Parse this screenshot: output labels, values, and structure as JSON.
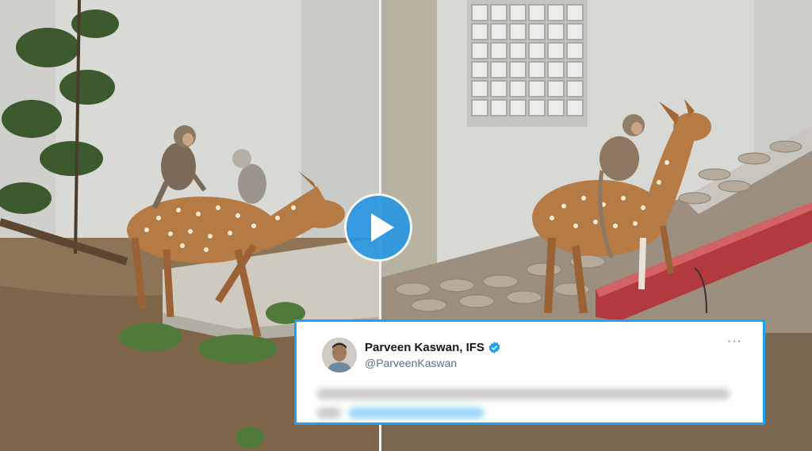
{
  "video": {
    "play_icon": "play-icon",
    "accent_color": "#2896e1"
  },
  "tweet": {
    "display_name": "Parveen Kaswan, IFS",
    "handle": "@ParveenKaswan",
    "verified_icon": "verified-badge-icon",
    "more_icon": "more-options-icon",
    "more_label": "···",
    "border_color": "#1da1f2"
  }
}
